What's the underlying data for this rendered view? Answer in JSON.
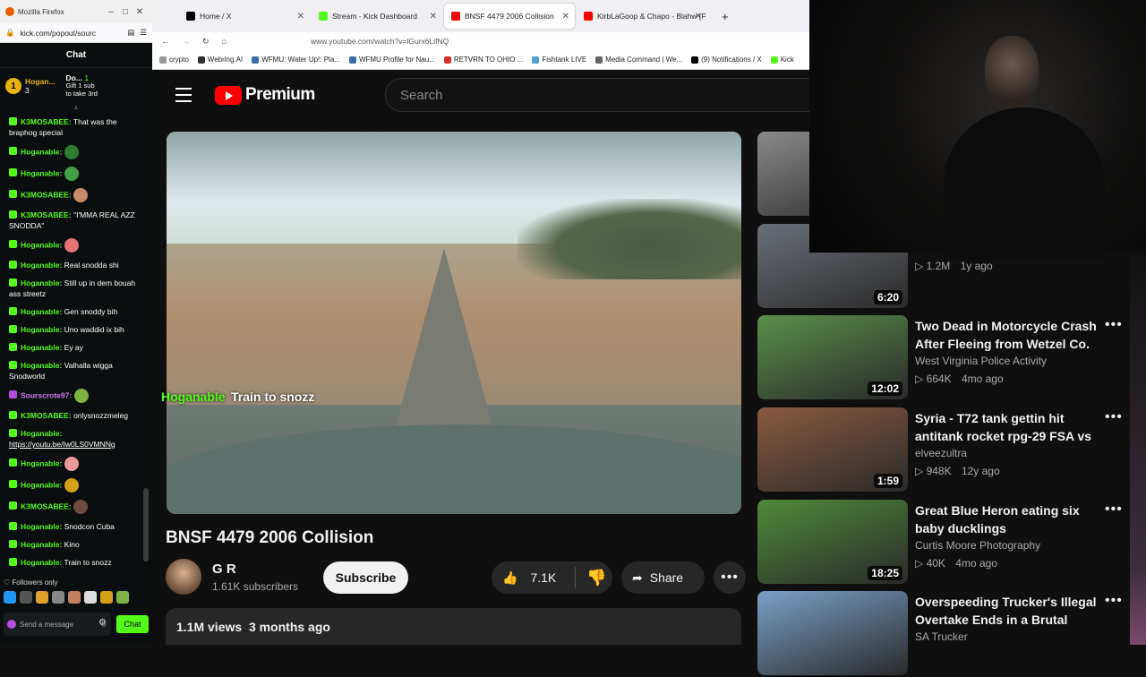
{
  "chat_window": {
    "title": "Mozilla Firefox",
    "url": "kick.com/popout/sourc",
    "header": "Chat",
    "pinned": {
      "badge": "1",
      "user": "Hogan...",
      "count": "3",
      "gifter": "Do...",
      "gift_count": "1",
      "gift_text": "Gift 1 sub",
      "gift_text2": "to take 3rd"
    },
    "messages": [
      {
        "user": "K3MOSABEE:",
        "text": "That was the braphog special",
        "color": "#53fc18",
        "icon_color": "#53fc18"
      },
      {
        "user": "Hoganable:",
        "text": "",
        "color": "#53fc18",
        "icon_color": "#53fc18",
        "emote": "#2e7d32"
      },
      {
        "user": "Hoganable:",
        "text": "",
        "color": "#53fc18",
        "icon_color": "#53fc18",
        "emote": "#43a047"
      },
      {
        "user": "K3MOSABEE:",
        "text": "",
        "color": "#53fc18",
        "icon_color": "#53fc18",
        "emote": "#c98a6a"
      },
      {
        "user": "K3MOSABEE:",
        "text": "\"I'MMA REAL AZZ SNODDA\"",
        "color": "#53fc18",
        "icon_color": "#53fc18"
      },
      {
        "user": "Hoganable:",
        "text": "",
        "color": "#53fc18",
        "icon_color": "#53fc18",
        "emote": "#e57373"
      },
      {
        "user": "Hoganable:",
        "text": "Real snodda shi",
        "color": "#53fc18",
        "icon_color": "#53fc18"
      },
      {
        "user": "Hoganable:",
        "text": "Still up in dem bouah ass streetz",
        "color": "#53fc18",
        "icon_color": "#53fc18"
      },
      {
        "user": "Hoganable:",
        "text": "Gen snoddy bih",
        "color": "#53fc18",
        "icon_color": "#53fc18"
      },
      {
        "user": "Hoganable:",
        "text": "Uno waddid ix bih",
        "color": "#53fc18",
        "icon_color": "#53fc18"
      },
      {
        "user": "Hoganable:",
        "text": "Ey ay",
        "color": "#53fc18",
        "icon_color": "#53fc18"
      },
      {
        "user": "Hoganable:",
        "text": "Valhalla wigga Snodworld",
        "color": "#53fc18",
        "icon_color": "#53fc18"
      },
      {
        "user": "Sourscrote97:",
        "text": "",
        "color": "#d27cf7",
        "icon_color": "#b44ddb",
        "emote": "#7cb342"
      },
      {
        "user": "K3MOSABEE:",
        "text": "onlysnozzmeleg",
        "color": "#53fc18",
        "icon_color": "#53fc18"
      },
      {
        "user": "Hoganable:",
        "text": "https://youtu.be/Iw0LS0VMNNg",
        "color": "#53fc18",
        "icon_color": "#53fc18",
        "link": true
      },
      {
        "user": "Hoganable:",
        "text": "",
        "color": "#53fc18",
        "icon_color": "#53fc18",
        "emote": "#ef9a9a"
      },
      {
        "user": "Hoganable:",
        "text": "",
        "color": "#53fc18",
        "icon_color": "#53fc18",
        "emote": "#d4a017"
      },
      {
        "user": "K3MOSABEE:",
        "text": "",
        "color": "#53fc18",
        "icon_color": "#53fc18",
        "emote": "#6d4c41"
      },
      {
        "user": "Hoganable:",
        "text": "Snodcon Cuba",
        "color": "#53fc18",
        "icon_color": "#53fc18"
      },
      {
        "user": "Hoganable:",
        "text": "Kino",
        "color": "#53fc18",
        "icon_color": "#53fc18"
      },
      {
        "user": "Hoganable:",
        "text": "Train to snozz",
        "color": "#53fc18",
        "icon_color": "#53fc18"
      }
    ],
    "followers_only": "Followers only",
    "input_placeholder": "Send a message",
    "chat_button": "Chat"
  },
  "browser": {
    "tabs": [
      {
        "label": "Home / X",
        "color": "#000000"
      },
      {
        "label": "Stream - Kick Dashboard",
        "color": "#53fc18"
      },
      {
        "label": "BNSF 4479 2006 Collision",
        "color": "#ff0000"
      },
      {
        "label": "KirbLaGoop & Chapo - Blahw [F",
        "color": "#ff0000"
      }
    ],
    "new_tab": "+",
    "address": "www.youtube.com/watch?v=lGurx6LifNQ",
    "bookmarks": [
      "crypto",
      "Webring.AI",
      "WFMU: Water Up!: Pla...",
      "WFMU Profile for Nau...",
      "RETVRN TO OHIO ...",
      "Fishtank LIVE",
      "Media Command | We...",
      "(9) Notifications / X",
      "Kick"
    ]
  },
  "youtube": {
    "logo": "Premium",
    "search_placeholder": "Search",
    "overlay": {
      "name": "Hoganable",
      "message": "Train to snozz"
    },
    "video_title": "BNSF 4479 2006 Collision",
    "channel": "G R",
    "subscribers": "1.61K subscribers",
    "subscribe": "Subscribe",
    "likes": "7.1K",
    "share": "Share",
    "more": "•••",
    "views": "1.1M views",
    "age": "3 months ago"
  },
  "recommendations": [
    {
      "title": "",
      "channel": "",
      "views": "",
      "age": "",
      "duration": "",
      "thumb": "#8a8a8a"
    },
    {
      "title": "",
      "channel": "",
      "views": "1.2M",
      "age": "1y ago",
      "duration": "6:20",
      "thumb": "#6a6f78"
    },
    {
      "title": "Two Dead in Motorcycle Crash After Fleeing from Wetzel Co. ...",
      "channel": "West Virginia Police Activity",
      "views": "664K",
      "age": "4mo ago",
      "duration": "12:02",
      "thumb": "#5a8f4a"
    },
    {
      "title": "Syria - T72 tank gettin hit antitank rocket rpg-29 FSA vs ...",
      "channel": "elveezultra",
      "views": "948K",
      "age": "12y ago",
      "duration": "1:59",
      "thumb": "#8a5a40"
    },
    {
      "title": "Great Blue Heron eating six baby ducklings",
      "channel": "Curtis Moore Photography",
      "views": "40K",
      "age": "4mo ago",
      "duration": "18:25",
      "thumb": "#4f8a3a"
    },
    {
      "title": "Overspeeding Trucker's Illegal Overtake Ends in a Brutal Crash",
      "channel": "SA Trucker",
      "views": "",
      "age": "",
      "duration": "",
      "thumb": "#7aa0c8"
    }
  ]
}
